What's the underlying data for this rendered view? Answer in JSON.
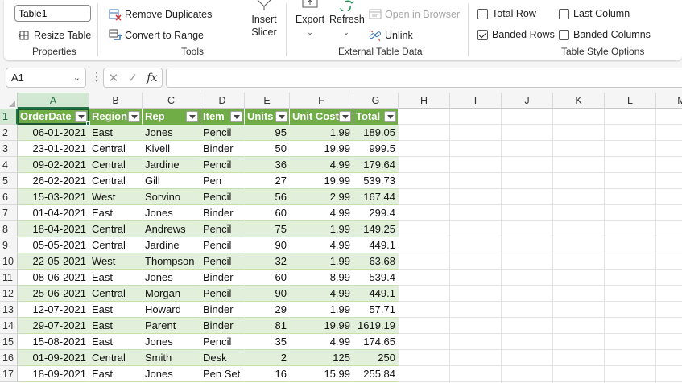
{
  "ribbon": {
    "table_name": "Table1",
    "properties": {
      "resize_table": "Resize Table",
      "group_label": "Properties"
    },
    "tools": {
      "remove_duplicates": "Remove Duplicates",
      "convert_to_range": "Convert to Range",
      "insert_slicer_line1": "Insert",
      "insert_slicer_line2": "Slicer",
      "group_label": "Tools"
    },
    "external": {
      "export": "Export",
      "refresh": "Refresh",
      "open_in_browser": "Open in Browser",
      "unlink": "Unlink",
      "group_label": "External Table Data"
    },
    "style_options": {
      "group_label": "Table Style Options",
      "header_row_checked": true,
      "total_row": {
        "label": "Total Row",
        "checked": false
      },
      "banded_rows": {
        "label": "Banded Rows",
        "checked": true
      },
      "last_column": {
        "label": "Last Column",
        "checked": false
      },
      "banded_columns": {
        "label": "Banded Columns",
        "checked": false
      }
    }
  },
  "formula_bar": {
    "name_box": "A1",
    "fx": "fx",
    "formula": ""
  },
  "colors": {
    "table_header": "#70ad47",
    "band": "#e2efda",
    "accent": "#217346"
  },
  "grid": {
    "columns": [
      "A",
      "B",
      "C",
      "D",
      "E",
      "F",
      "G",
      "H",
      "I",
      "J",
      "K",
      "L",
      "M"
    ],
    "table_headers": [
      "OrderDate",
      "Region",
      "Rep",
      "Item",
      "Units",
      "Unit Cost",
      "Total"
    ],
    "rows": [
      [
        "06-01-2021",
        "East",
        "Jones",
        "Pencil",
        "95",
        "1.99",
        "189.05"
      ],
      [
        "23-01-2021",
        "Central",
        "Kivell",
        "Binder",
        "50",
        "19.99",
        "999.5"
      ],
      [
        "09-02-2021",
        "Central",
        "Jardine",
        "Pencil",
        "36",
        "4.99",
        "179.64"
      ],
      [
        "26-02-2021",
        "Central",
        "Gill",
        "Pen",
        "27",
        "19.99",
        "539.73"
      ],
      [
        "15-03-2021",
        "West",
        "Sorvino",
        "Pencil",
        "56",
        "2.99",
        "167.44"
      ],
      [
        "01-04-2021",
        "East",
        "Jones",
        "Binder",
        "60",
        "4.99",
        "299.4"
      ],
      [
        "18-04-2021",
        "Central",
        "Andrews",
        "Pencil",
        "75",
        "1.99",
        "149.25"
      ],
      [
        "05-05-2021",
        "Central",
        "Jardine",
        "Pencil",
        "90",
        "4.99",
        "449.1"
      ],
      [
        "22-05-2021",
        "West",
        "Thompson",
        "Pencil",
        "32",
        "1.99",
        "63.68"
      ],
      [
        "08-06-2021",
        "East",
        "Jones",
        "Binder",
        "60",
        "8.99",
        "539.4"
      ],
      [
        "25-06-2021",
        "Central",
        "Morgan",
        "Pencil",
        "90",
        "4.99",
        "449.1"
      ],
      [
        "12-07-2021",
        "East",
        "Howard",
        "Binder",
        "29",
        "1.99",
        "57.71"
      ],
      [
        "29-07-2021",
        "East",
        "Parent",
        "Binder",
        "81",
        "19.99",
        "1619.19"
      ],
      [
        "15-08-2021",
        "East",
        "Jones",
        "Pencil",
        "35",
        "4.99",
        "174.65"
      ],
      [
        "01-09-2021",
        "Central",
        "Smith",
        "Desk",
        "2",
        "125",
        "250"
      ],
      [
        "18-09-2021",
        "East",
        "Jones",
        "Pen Set",
        "16",
        "15.99",
        "255.84"
      ]
    ]
  }
}
